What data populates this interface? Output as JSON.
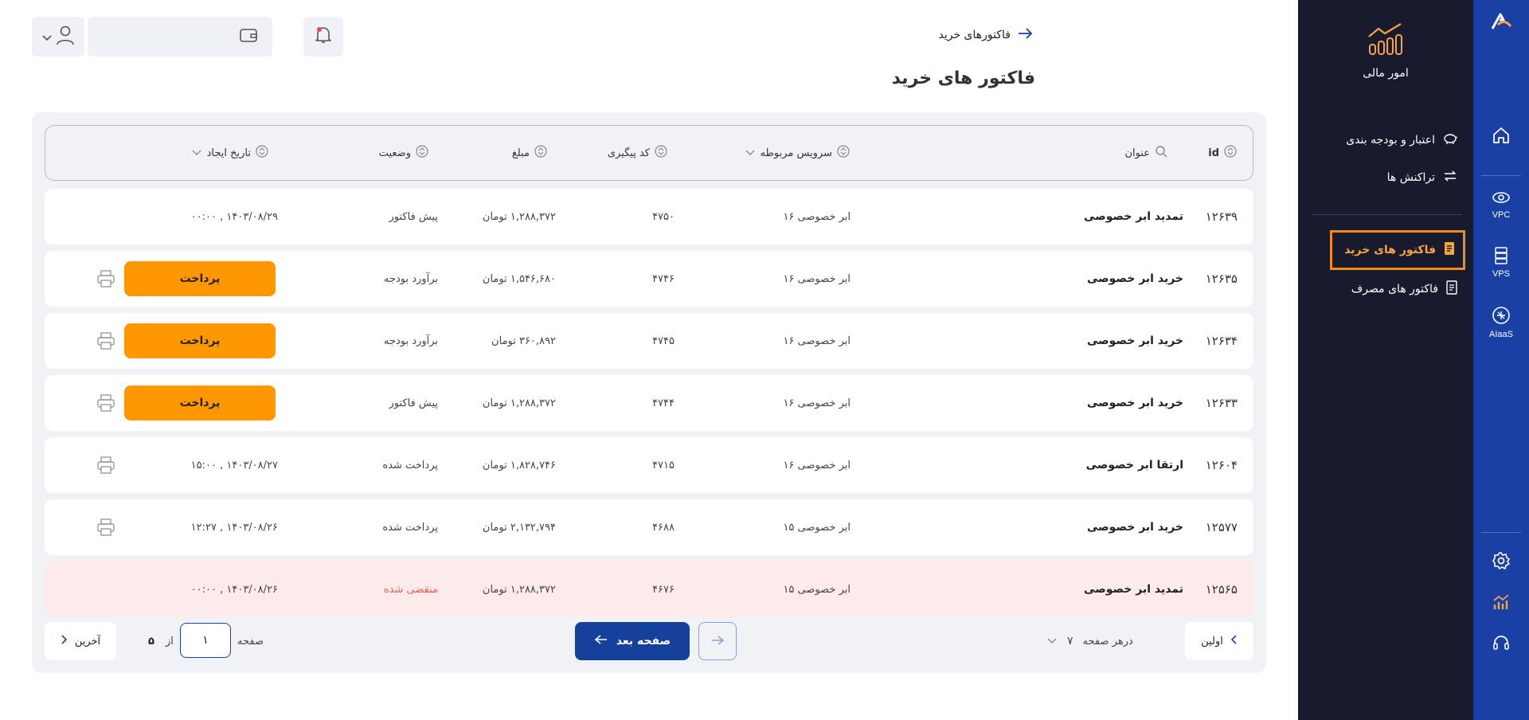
{
  "rail": {
    "items": [
      {
        "label": "",
        "icon": "home-icon"
      },
      {
        "label": "VPC",
        "icon": "vpc-icon"
      },
      {
        "label": "VPS",
        "icon": "server-icon"
      },
      {
        "label": "AIaaS",
        "icon": "brain-icon"
      }
    ],
    "bottom": [
      "gear-icon",
      "finance-chart-icon",
      "headset-icon"
    ]
  },
  "sidebar": {
    "module_name": "امور مالی",
    "items": [
      {
        "label": "اعتبار و بودجه بندی",
        "icon": "piggy-bank-icon"
      },
      {
        "label": "تراکنش ها",
        "icon": "transfer-icon"
      },
      {
        "label": "فاکتور های خرید",
        "icon": "invoice-icon",
        "active": true
      },
      {
        "label": "فاکتور های مصرف",
        "icon": "invoice-icon"
      }
    ]
  },
  "header": {
    "breadcrumb": "فاکتورهای خرید",
    "title": "فاکتور های خرید"
  },
  "table": {
    "columns": {
      "id": "id",
      "title": "عنوان",
      "service": "سرویس مربوطه",
      "tracking": "کد پیگیری",
      "amount": "مبلغ",
      "status": "وضعیت",
      "created": "تاریخ ایجاد"
    },
    "pay_label": "پرداخت",
    "rows": [
      {
        "id": "۱۲۶۳۹",
        "title": "تمدید ابر خصوصی",
        "service": "ابر خصوصی ۱۶",
        "tracking": "۴۷۵۰",
        "amount": "۱,۲۸۸,۳۷۲ تومان",
        "status": "پیش فاکتور",
        "created": "۱۴۰۳/۰۸/۲۹ , ۰۰:۰۰",
        "pay": false,
        "print": false,
        "expired": false
      },
      {
        "id": "۱۲۶۳۵",
        "title": "خرید ابر خصوصی",
        "service": "ابر خصوصی ۱۶",
        "tracking": "۴۷۴۶",
        "amount": "۱,۵۴۶,۶۸۰ تومان",
        "status": "برآورد بودجه",
        "created": "",
        "pay": true,
        "print": true,
        "expired": false
      },
      {
        "id": "۱۲۶۳۴",
        "title": "خرید ابر خصوصی",
        "service": "ابر خصوصی ۱۶",
        "tracking": "۴۷۴۵",
        "amount": "۳۶۰,۸۹۲ تومان",
        "status": "برآورد بودجه",
        "created": "",
        "pay": true,
        "print": true,
        "expired": false
      },
      {
        "id": "۱۲۶۳۳",
        "title": "خرید ابر خصوصی",
        "service": "ابر خصوصی ۱۶",
        "tracking": "۴۷۴۴",
        "amount": "۱,۲۸۸,۳۷۲ تومان",
        "status": "پیش فاکتور",
        "created": "",
        "pay": true,
        "print": true,
        "expired": false
      },
      {
        "id": "۱۲۶۰۴",
        "title": "ارتقا ابر خصوصی",
        "service": "ابر خصوصی ۱۶",
        "tracking": "۴۷۱۵",
        "amount": "۱,۸۲۸,۷۴۶ تومان",
        "status": "پرداخت شده",
        "created": "۱۴۰۳/۰۸/۲۷ , ۱۵:۰۰",
        "pay": false,
        "print": true,
        "expired": false
      },
      {
        "id": "۱۲۵۷۷",
        "title": "خرید ابر خصوصی",
        "service": "ابر خصوصی ۱۵",
        "tracking": "۴۶۸۸",
        "amount": "۲,۱۳۲,۷۹۴ تومان",
        "status": "پرداخت شده",
        "created": "۱۴۰۳/۰۸/۲۶ , ۱۲:۲۷",
        "pay": false,
        "print": true,
        "expired": false
      },
      {
        "id": "۱۲۵۶۵",
        "title": "تمدید ابر خصوصی",
        "service": "ابر خصوصی ۱۵",
        "tracking": "۴۶۷۶",
        "amount": "۱,۲۸۸,۳۷۲ تومان",
        "status": "منقضی شده",
        "created": "۱۴۰۳/۰۸/۲۶ , ۰۰:۰۰",
        "pay": false,
        "print": false,
        "expired": true
      }
    ]
  },
  "pagination": {
    "first": "اولین",
    "per_page_value": "۷",
    "per_page_label": "درهر صفحه",
    "next": "صفحه بعد",
    "page_label": "صفحه",
    "page_value": "۱",
    "of_label": "از",
    "total_pages": "۵",
    "last": "آخرین"
  },
  "colors": {
    "rail": "#1a40a6",
    "sidebar": "#171b2d",
    "accent": "#f28a1e",
    "pay": "#ff9800",
    "next": "#15409c",
    "expired_bg": "#fdebec",
    "expired_text": "#ee5a5a"
  }
}
